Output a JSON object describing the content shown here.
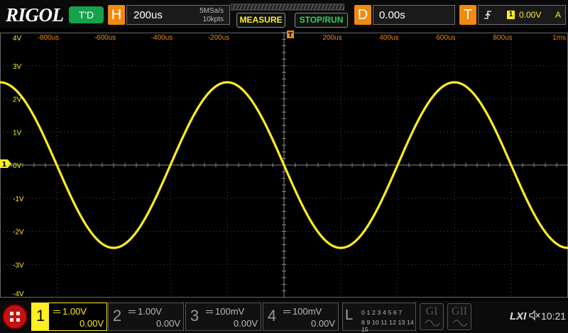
{
  "brand": "RIGOL",
  "trigger_status": "T'D",
  "horizontal": {
    "letter": "H",
    "timebase": "200us",
    "sample_rate": "5MSa/s",
    "memory_depth": "10kpts"
  },
  "buttons": {
    "measure": "MEASURE",
    "stop_run": "STOP/RUN"
  },
  "delay": {
    "letter": "D",
    "value": "0.00s"
  },
  "trigger": {
    "letter": "T",
    "edge_icon": "rising-edge-icon",
    "source": "1",
    "level": "0.00V",
    "mode": "A"
  },
  "time_labels": [
    "-800us",
    "-600us",
    "-400us",
    "-200us",
    "200us",
    "400us",
    "600us",
    "800us",
    "1ms"
  ],
  "voltage_labels": [
    "4V",
    "3V",
    "2V",
    "1V",
    "0V",
    "-1V",
    "-2V",
    "-3V",
    "-4V"
  ],
  "channel1_marker": "1",
  "waveform": {
    "type": "sine",
    "channel": "1",
    "color": "#ffee22",
    "amplitude_v": 2.5,
    "period_us": 800,
    "x_range_us": [
      -1000,
      1000
    ],
    "y_range_v": [
      -4,
      4
    ]
  },
  "channels": [
    {
      "num": "1",
      "scale": "1.00V",
      "offset": "0.00V",
      "active": true
    },
    {
      "num": "2",
      "scale": "1.00V",
      "offset": "0.00V",
      "active": false
    },
    {
      "num": "3",
      "scale": "100mV",
      "offset": "0.00V",
      "active": false
    },
    {
      "num": "4",
      "scale": "100mV",
      "offset": "0.00V",
      "active": false
    }
  ],
  "logic": {
    "letter": "L",
    "row1": "0 1 2 3 4 5 6 7",
    "row2": "8 9 10 11 12 13 14 15"
  },
  "generators": [
    "GI",
    "GII"
  ],
  "status_bar": {
    "lxi": "LXI",
    "speaker_icon": "speaker-muted-icon",
    "time": "10:21"
  },
  "colors": {
    "channel1": "#ffee22",
    "accent_orange": "#f08a10",
    "run_green": "#15a24a",
    "home_red": "#c81010"
  }
}
